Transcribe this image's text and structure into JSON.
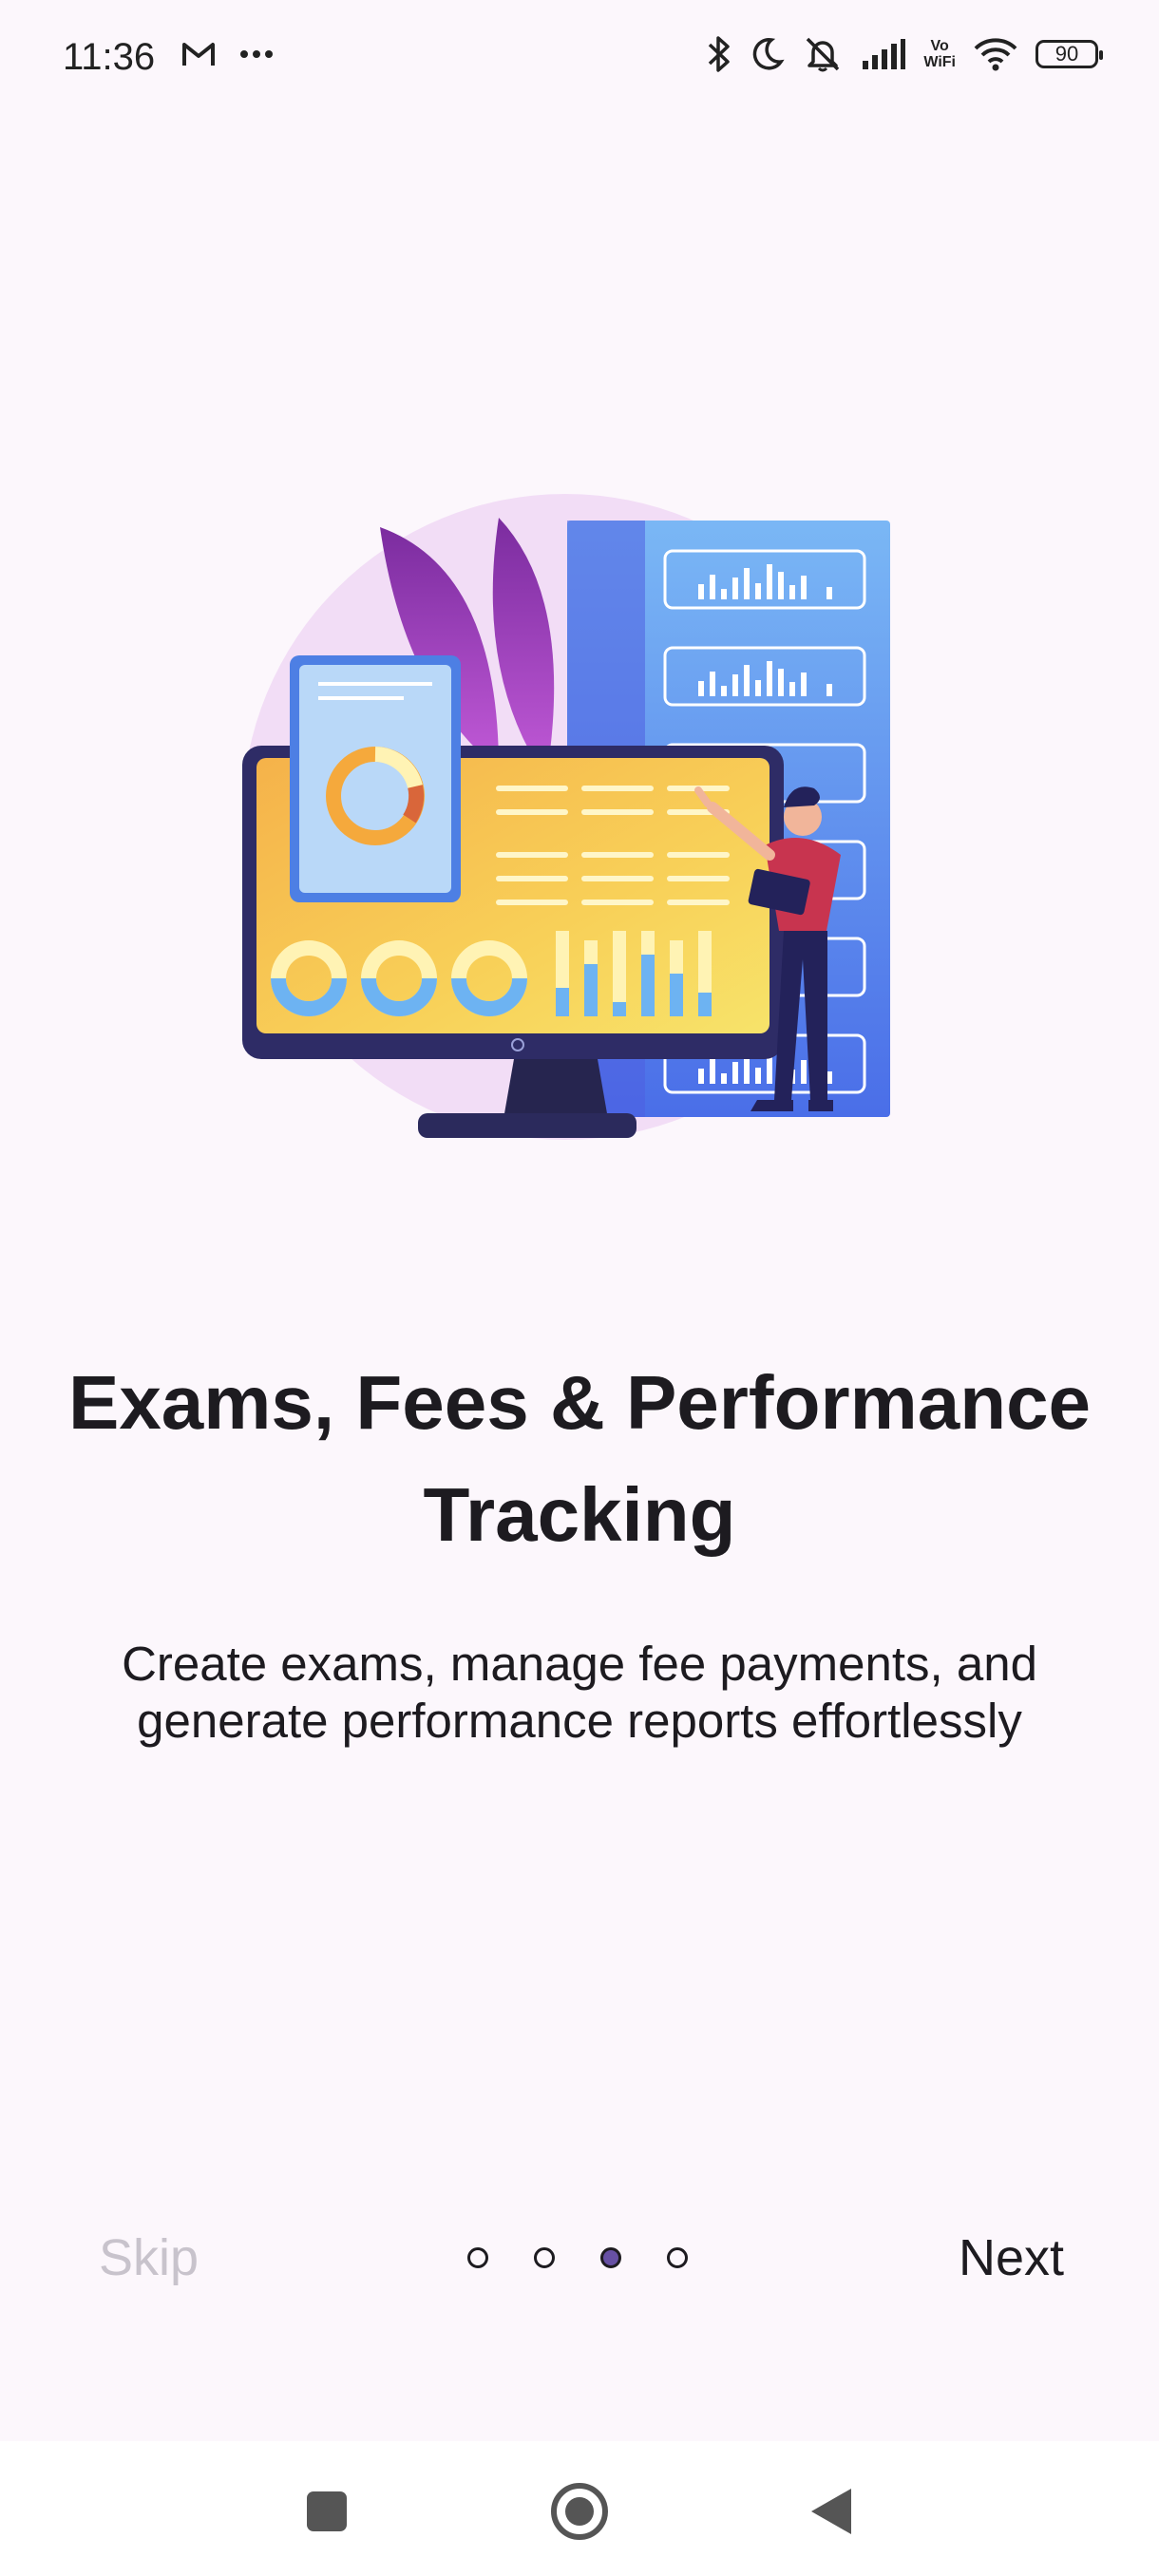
{
  "status_bar": {
    "time": "11:36",
    "battery_level": "90",
    "vowifi_top": "Vo",
    "vowifi_bottom": "WiFi",
    "icons": [
      "gmail-icon",
      "more-dots-icon",
      "bluetooth-icon",
      "moon-icon",
      "mute-icon",
      "signal-icon",
      "vowifi-icon",
      "wifi-icon",
      "battery-icon"
    ]
  },
  "onboarding": {
    "title": "Exams, Fees & Performance Tracking",
    "description": "Create exams, manage fee payments, and generate performance reports effortlessly",
    "skip_label": "Skip",
    "next_label": "Next",
    "page_count": 4,
    "current_page": 3,
    "accent_color": "#6750a4",
    "skip_color": "#c8c3cc"
  },
  "system_nav": {
    "buttons": [
      "recents-button",
      "home-button",
      "back-button"
    ]
  }
}
